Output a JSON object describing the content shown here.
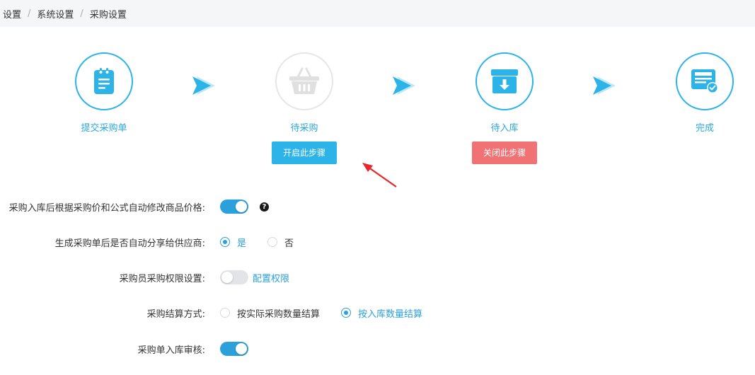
{
  "breadcrumb": [
    "设置",
    "系统设置",
    "采购设置"
  ],
  "breadcrumb_separator": "/",
  "steps": [
    {
      "label": "提交采购单",
      "icon": "purchase-order-icon"
    },
    {
      "label": "待采购",
      "icon": "basket-icon",
      "button": "开启此步骤"
    },
    {
      "label": "待入库",
      "icon": "warehouse-box-icon",
      "button": "关闭此步骤"
    },
    {
      "label": "完成",
      "icon": "completed-document-icon"
    }
  ],
  "settings": {
    "auto_price": {
      "label": "采购入库后根据采购价和公式自动修改商品价格:",
      "enabled": true,
      "help": "?"
    },
    "share_supplier": {
      "label": "生成采购单后是否自动分享给供应商:",
      "options": [
        "是",
        "否"
      ],
      "selected": "是"
    },
    "permission": {
      "label": "采购员采购权限设置:",
      "enabled": false,
      "link": "配置权限"
    },
    "settlement": {
      "label": "采购结算方式:",
      "options": [
        "按实际采购数量结算",
        "按入库数量结算"
      ],
      "selected": "按入库数量结算"
    },
    "inbound_audit": {
      "label": "采购单入库审核:",
      "enabled": true
    }
  },
  "colors": {
    "accent": "#2cb3e8",
    "danger": "#f07274",
    "inactive": "#e6e6e6",
    "annotation": "#e8262b"
  }
}
